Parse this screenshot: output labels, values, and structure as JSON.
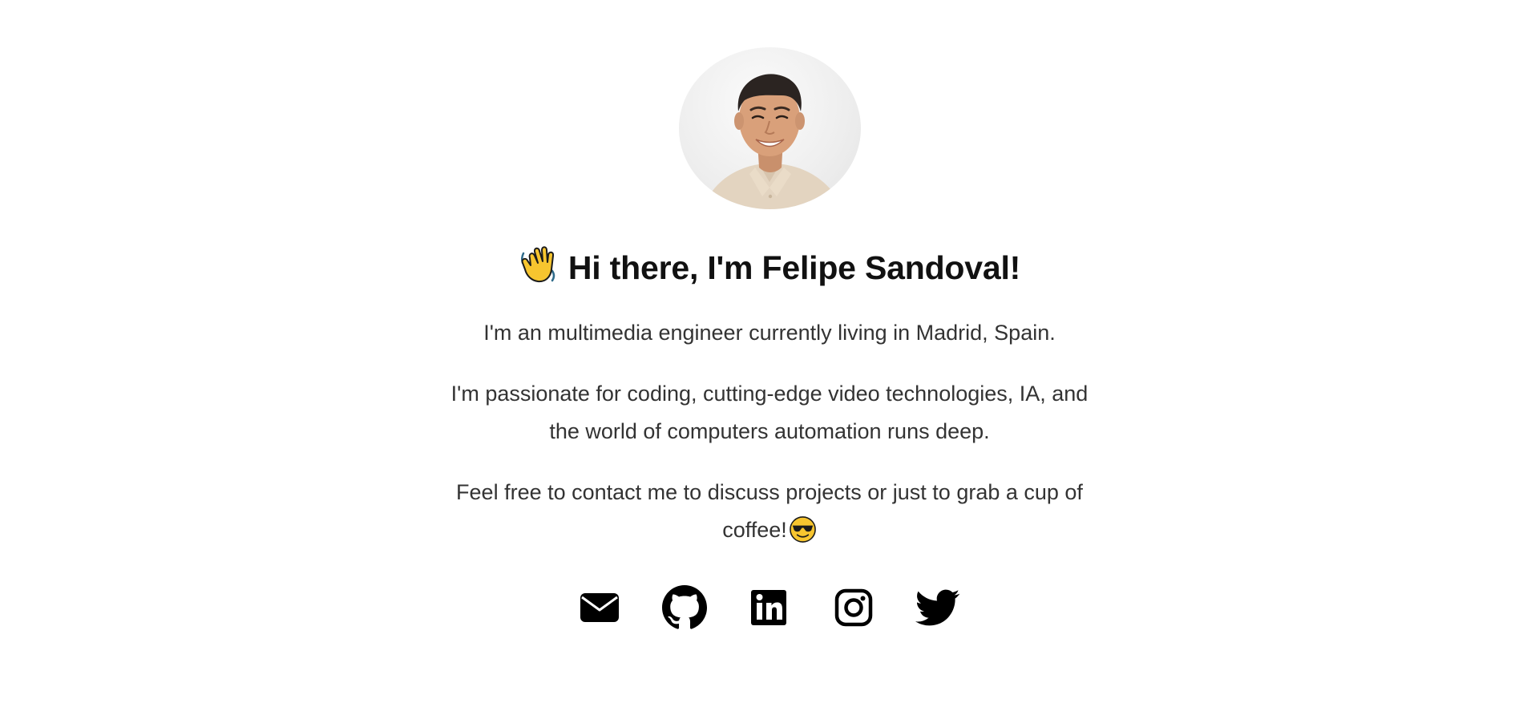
{
  "profile": {
    "photo_alt": "Felipe Sandoval"
  },
  "greeting": {
    "emoji": "waving-hand",
    "text": "Hi there, I'm Felipe Sandoval!"
  },
  "bio": {
    "line1": "I'm an multimedia engineer currently living in Madrid, Spain.",
    "line2": "I'm passionate for coding, cutting-edge video technologies, IA, and the world of computers automation runs deep.",
    "line3": "Feel free to contact me to discuss projects or just to grab a cup of coffee!",
    "line3_emoji": "smiling-face-with-sunglasses"
  },
  "social": {
    "items": [
      {
        "icon": "envelope-icon",
        "label": "Email"
      },
      {
        "icon": "github-icon",
        "label": "GitHub"
      },
      {
        "icon": "linkedin-icon",
        "label": "LinkedIn"
      },
      {
        "icon": "instagram-icon",
        "label": "Instagram"
      },
      {
        "icon": "twitter-icon",
        "label": "Twitter"
      }
    ],
    "color": "#000000"
  },
  "colors": {
    "background": "#ffffff",
    "heading": "#111111",
    "body_text": "#333333",
    "emoji_yellow": "#f7c52f"
  }
}
